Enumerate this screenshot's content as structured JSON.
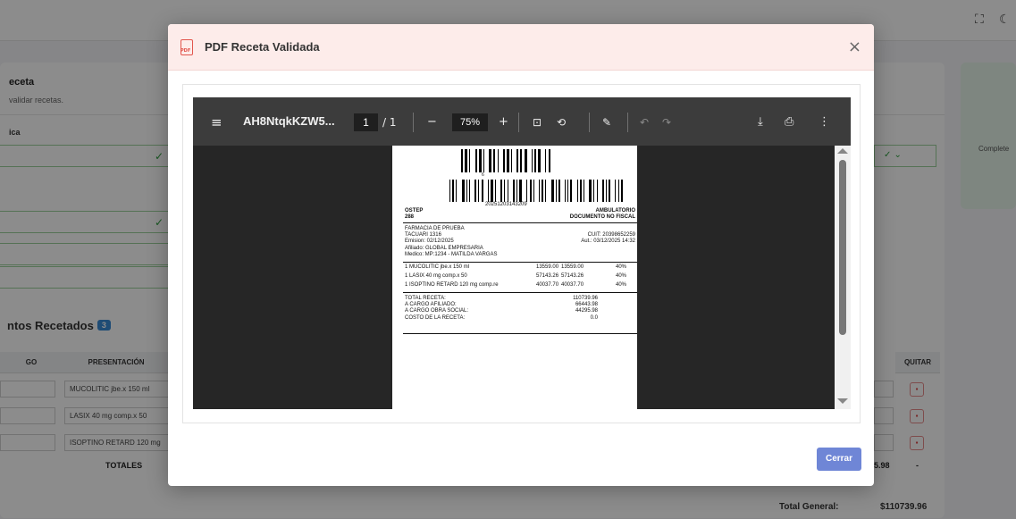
{
  "background": {
    "card_title": "eceta",
    "card_subtitle": "validar recetas.",
    "field_label": "ica",
    "side_card_text": "Complete",
    "section_title": "ntos Recetados",
    "section_badge": "3",
    "table": {
      "headers": [
        "GO",
        "PRESENTACIÓN",
        "QUITAR"
      ],
      "rows": [
        "MUCOLITIC jbe.x 150 ml",
        "LASIX 40 mg comp.x 50",
        "ISOPTINO RETARD 120 mg"
      ],
      "totals_label": "TOTALES",
      "totals_value": "5.98",
      "totals_dash": "-"
    },
    "total_general_label": "Total General:",
    "total_general_value": "$110739.96"
  },
  "modal": {
    "icon_text": "PDF",
    "title": "PDF Receta Validada",
    "close_symbol": "×",
    "close_button_label": "Cerrar"
  },
  "viewer": {
    "filename": "AH8NtqkKZW5...",
    "page_current": "1",
    "page_total": "/ 1",
    "zoom": "75%"
  },
  "receipt": {
    "barcode_small_num": "6",
    "barcode_number": "20251203143209",
    "org": "OSTEP",
    "org_code": "288",
    "type": "AMBULATORIO",
    "type_sub": "DOCUMENTO NO FISCAL",
    "pharmacy": "FARMACIA DE PRUEBA",
    "address": "TACUARI 1316",
    "cuit": "CUIT: 20398652259",
    "emission": "Emision: 02/12/2025",
    "aut": "Aut.: 03/12/2025 14:32",
    "affiliate": "Afiliado: GLOBAL EMPRESARIA",
    "doctor": "Medico: MP:1234 - MATILDA VARGAS",
    "items": [
      {
        "desc": "1 MUCOLITIC jbe.x 150 ml",
        "unit": "13559.00",
        "total": "13559.00",
        "pct": "40%"
      },
      {
        "desc": "1 LASIX 40 mg comp.x 50",
        "unit": "57143.26",
        "total": "57143.26",
        "pct": "40%"
      },
      {
        "desc": "1 ISOPTINO RETARD 120 mg comp.re",
        "unit": "40037.70",
        "total": "40037.70",
        "pct": "40%"
      }
    ],
    "totals": [
      {
        "label": "TOTAL RECETA:",
        "value": "110739.96"
      },
      {
        "label": "A CARGO AFILIADO:",
        "value": "66443.98"
      },
      {
        "label": "A CARGO OBRA SOCIAL:",
        "value": "44295.98"
      },
      {
        "label": "COSTO DE LA RECETA:",
        "value": "0.0"
      }
    ]
  }
}
